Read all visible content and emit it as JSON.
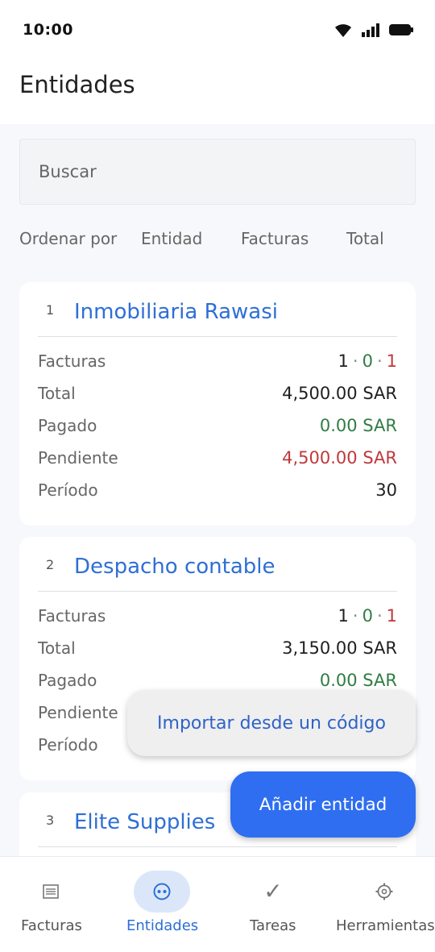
{
  "status_bar": {
    "time": "10:00"
  },
  "header": {
    "title": "Entidades"
  },
  "search": {
    "placeholder": "Buscar",
    "value": ""
  },
  "sort": {
    "label": "Ordenar por",
    "options": [
      "Entidad",
      "Facturas",
      "Total"
    ]
  },
  "row_labels": {
    "invoices": "Facturas",
    "total": "Total",
    "paid": "Pagado",
    "pending": "Pendiente",
    "period": "Período"
  },
  "entities": [
    {
      "index": "1",
      "name": "Inmobiliaria Rawasi",
      "invoices": {
        "a": "1",
        "b": "0",
        "c": "1"
      },
      "total": "4,500.00 SAR",
      "paid": "0.00 SAR",
      "pending": "4,500.00 SAR",
      "period": "30"
    },
    {
      "index": "2",
      "name": "Despacho contable",
      "invoices": {
        "a": "1",
        "b": "0",
        "c": "1"
      },
      "total": "3,150.00 SAR",
      "paid": "0.00 SAR"
    },
    {
      "index": "3",
      "name": "Elite Supplies"
    }
  ],
  "menu": {
    "import_label": "Importar desde un código"
  },
  "fab": {
    "label": "Añadir entidad"
  },
  "bottom_nav": {
    "items": [
      {
        "label": "Facturas",
        "icon": "list-icon"
      },
      {
        "label": "Entidades",
        "icon": "entities-icon",
        "active": true
      },
      {
        "label": "Tareas",
        "icon": "check-icon"
      },
      {
        "label": "Herramientas",
        "icon": "gear-icon"
      }
    ]
  },
  "colors": {
    "accent": "#2e6fd6",
    "fab": "#2f6ef0",
    "paid_green": "#2f7d43",
    "pending_red": "#c0383b"
  }
}
